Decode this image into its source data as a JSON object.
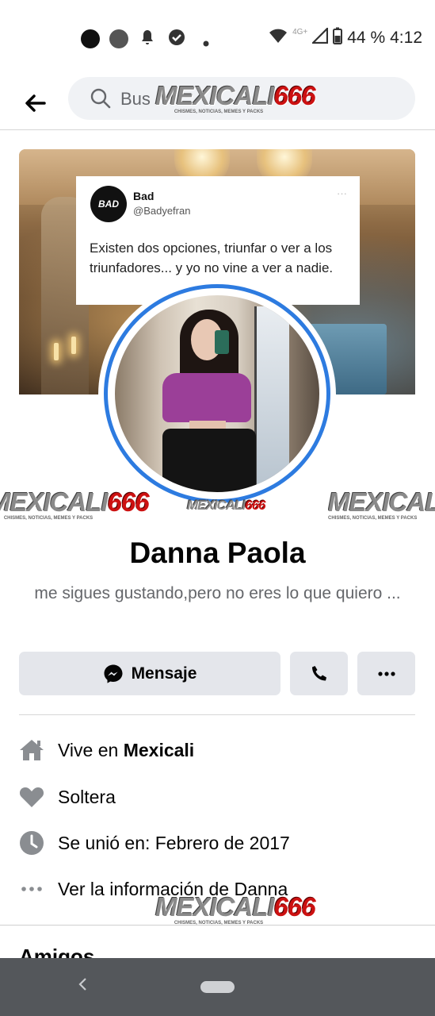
{
  "status_bar": {
    "battery": "44 %",
    "time": "4:12",
    "network": "4G+"
  },
  "header": {
    "search_placeholder": "Bus",
    "watermark_brand_a": "MEXICALI",
    "watermark_brand_b": "666",
    "watermark_tagline": "CHISMES, NOTICIAS, MEMES Y PACKS"
  },
  "cover": {
    "tweet_avatar_text": "BAD",
    "tweet_name": "Bad",
    "tweet_handle": "@Badyefran",
    "tweet_more": "···",
    "tweet_text": "Existen dos opciones, triunfar o ver a los triunfadores... y yo no vine a ver a nadie."
  },
  "profile": {
    "name": "Danna Paola",
    "bio": "me sigues gustando,pero no eres lo que quiero ..."
  },
  "actions": {
    "message_label": "Mensaje"
  },
  "intro": {
    "lives_prefix": "Vive en ",
    "lives_city": "Mexicali",
    "relationship": "Soltera",
    "joined": "Se unió en: Febrero de 2017",
    "see_info": "Ver la información de Danna"
  },
  "friends": {
    "title": "Amigos"
  },
  "colors": {
    "accent_blue": "#2d7be0",
    "button_gray": "#e4e6eb",
    "secondary_text": "#65676b",
    "nav_bar": "#54575b"
  }
}
